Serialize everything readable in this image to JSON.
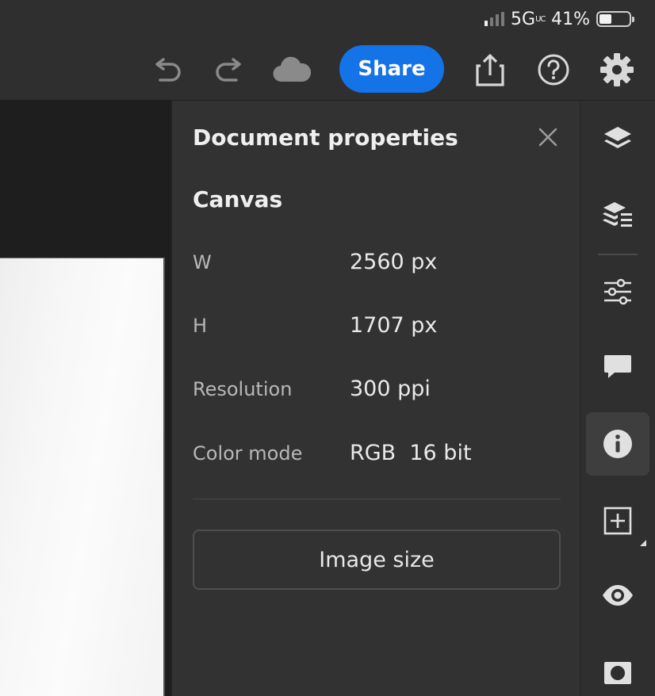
{
  "status_bar": {
    "network": "5G",
    "network_suffix": "UC",
    "battery_percent": "41%",
    "battery_level": 0.41,
    "signal_bars_active": 1,
    "signal_bars_total": 4
  },
  "toolbar": {
    "share_label": "Share",
    "icons": [
      "undo-icon",
      "redo-icon",
      "cloud-icon",
      "export-icon",
      "help-icon",
      "settings-icon"
    ],
    "accent_color": "#1473e6"
  },
  "panel": {
    "title": "Document properties",
    "section_title": "Canvas",
    "properties": [
      {
        "label": "W",
        "value": "2560 px"
      },
      {
        "label": "H",
        "value": "1707 px"
      },
      {
        "label": "Resolution",
        "value": "300 ppi"
      },
      {
        "label": "Color mode",
        "value": "RGB  16 bit"
      }
    ],
    "image_size_label": "Image size"
  },
  "rail": {
    "icons": [
      "layers-icon",
      "layer-properties-icon",
      "adjustments-icon",
      "comments-icon",
      "info-icon",
      "add-layer-icon",
      "visibility-icon",
      "mask-icon"
    ],
    "active": "info-icon"
  }
}
